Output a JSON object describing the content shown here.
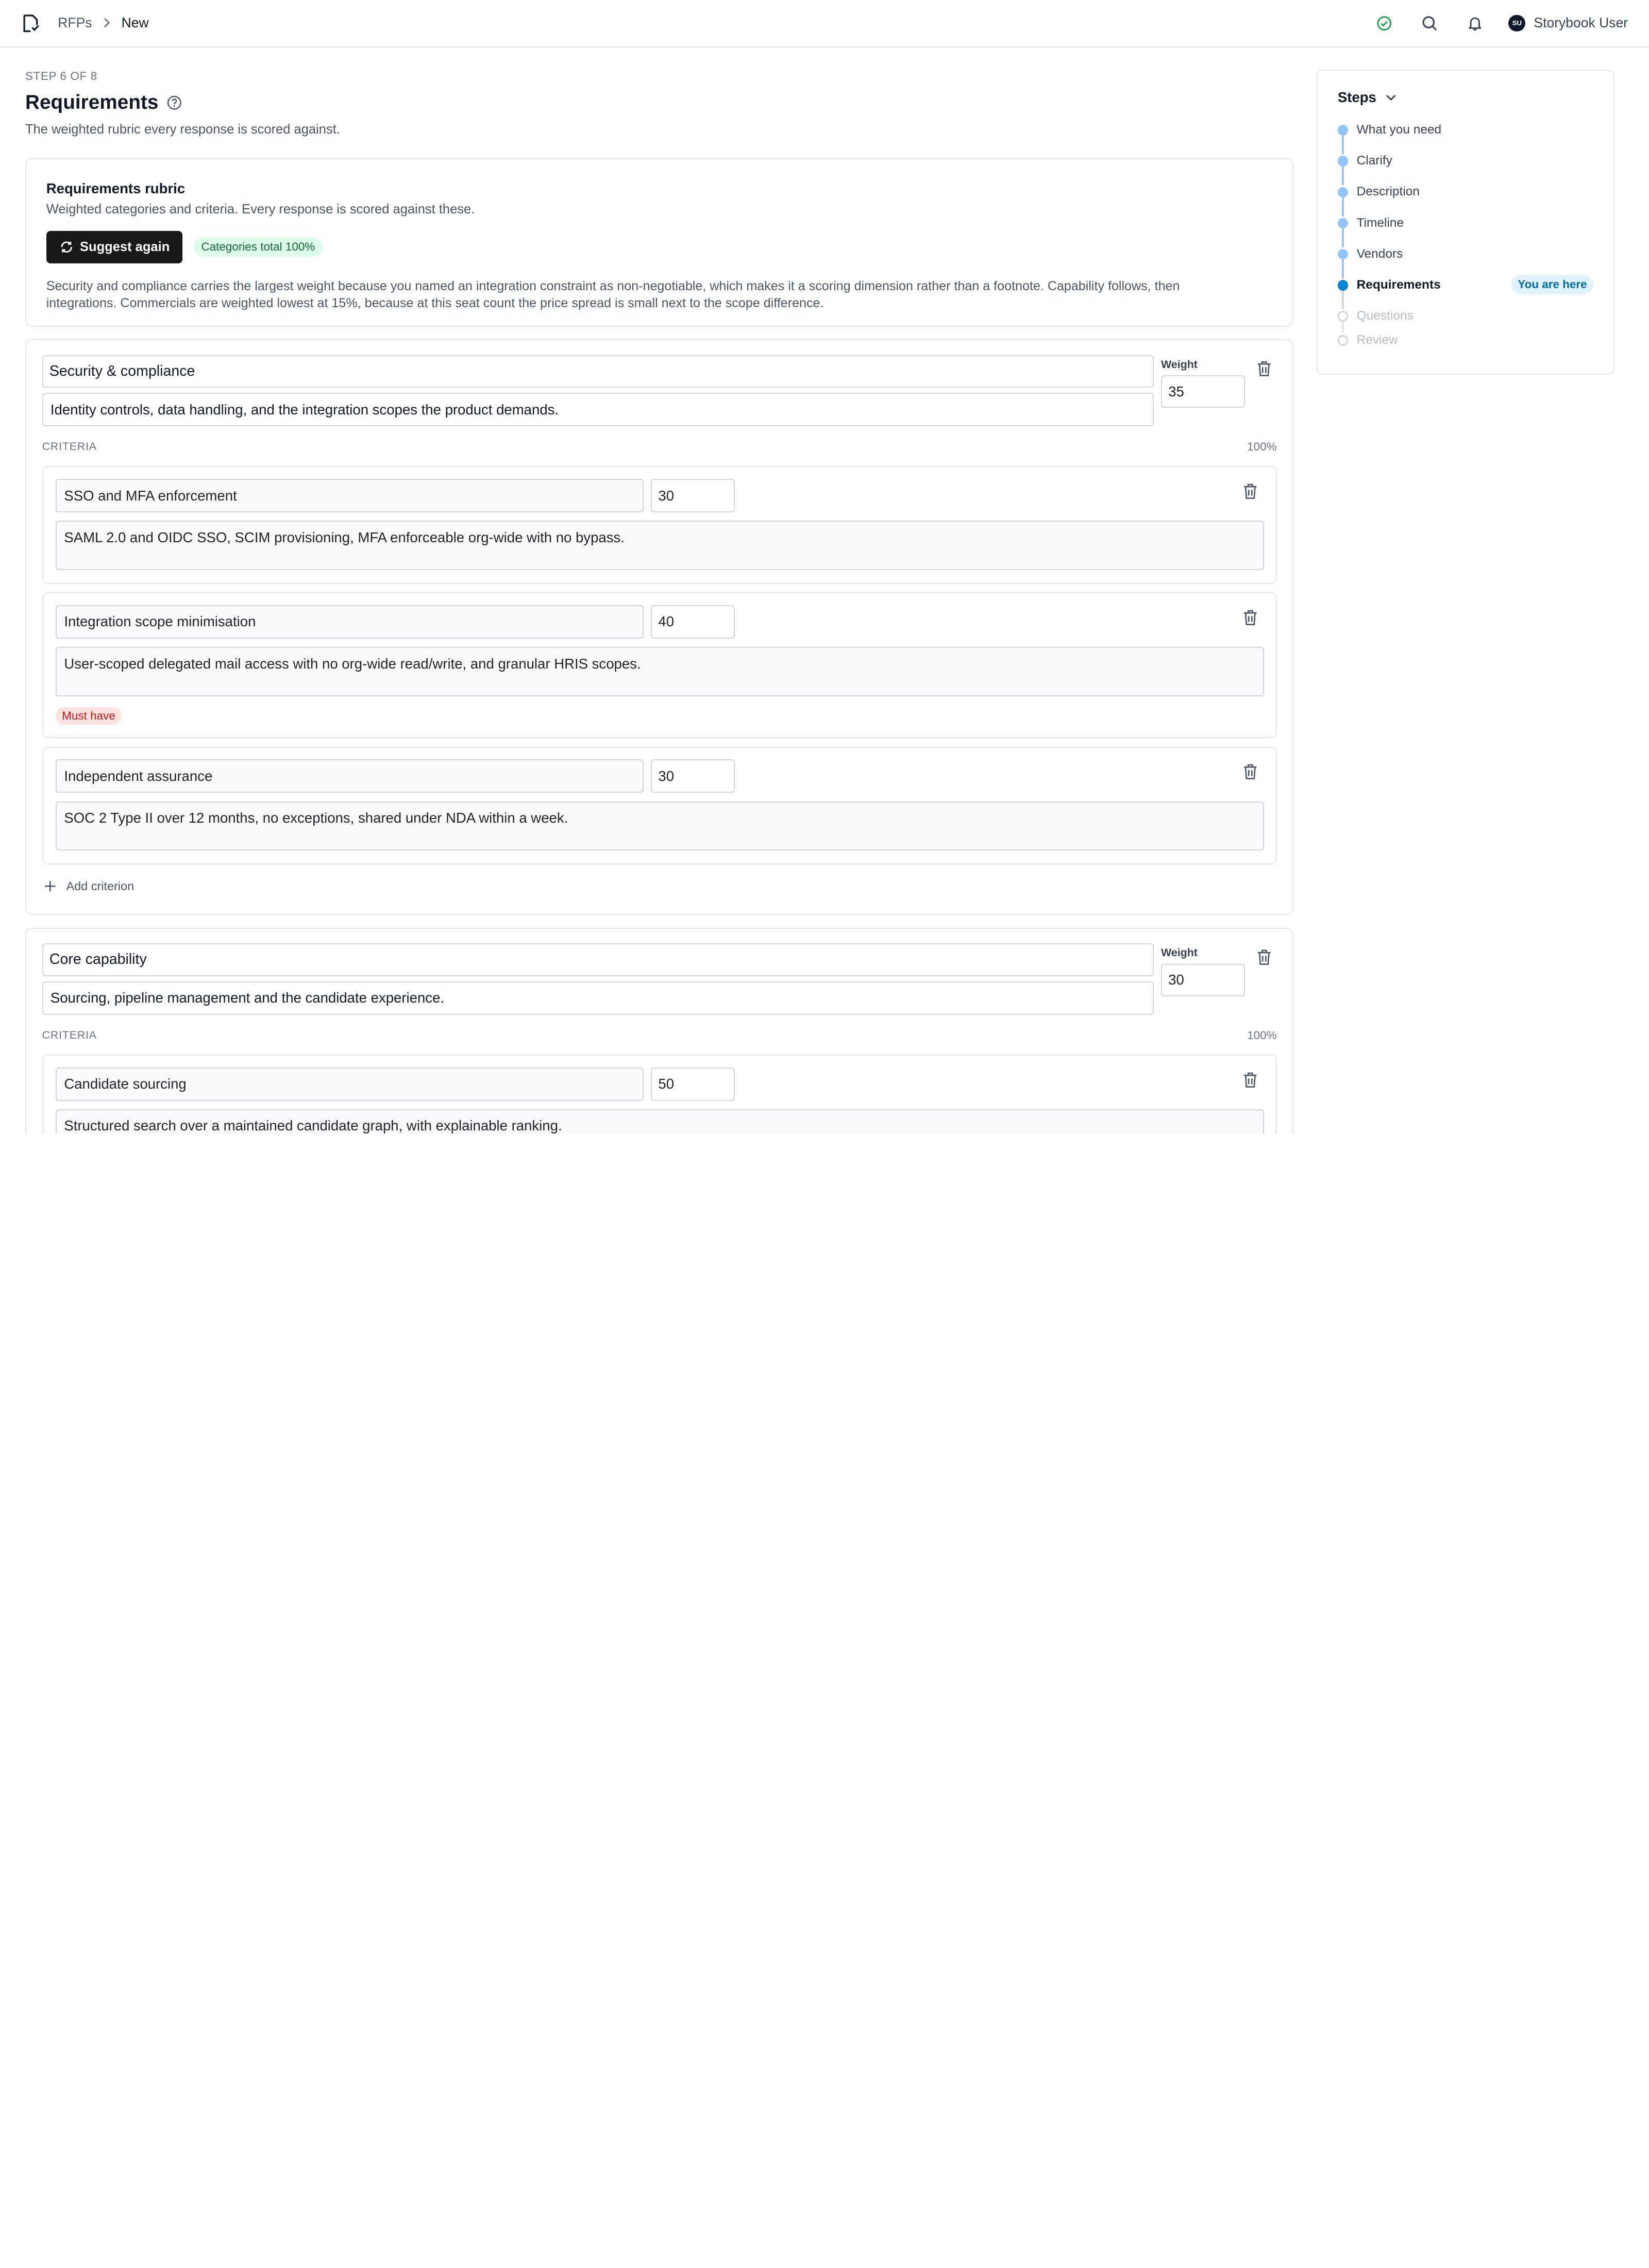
{
  "header": {
    "breadcrumb": [
      "RFPs",
      "New"
    ],
    "user_initials": "SU",
    "user_name": "Storybook User",
    "icons": [
      "app-logo-icon",
      "check-circle-icon",
      "search-icon",
      "bell-icon",
      "chevron-right-icon"
    ]
  },
  "page": {
    "step_label": "STEP 6 OF 8",
    "title": "Requirements",
    "subtitle": "The weighted rubric every response is scored against."
  },
  "rubric": {
    "title": "Requirements rubric",
    "subtitle": "Weighted categories and criteria. Every response is scored against these.",
    "suggest_label": "Suggest again",
    "total_badge": "Categories total 100%",
    "note": "Security and compliance carries the largest weight because you named an integration constraint as non-negotiable, which makes it a scoring dimension rather than a footnote. Capability follows, then integrations. Commercials are weighted lowest at 15%, because at this seat count the price spread is small next to the scope difference."
  },
  "labels": {
    "weight": "Weight",
    "criteria": "CRITERIA",
    "add_criterion": "Add criterion",
    "must_have": "Must have"
  },
  "categories": [
    {
      "name": "Security & compliance",
      "description": "Identity controls, data handling, and the integration scopes the product demands.",
      "weight": "35",
      "criteria_total": "100%",
      "criteria": [
        {
          "name": "SSO and MFA enforcement",
          "weight": "30",
          "description": "SAML 2.0 and OIDC SSO, SCIM provisioning, MFA enforceable org-wide with no bypass.",
          "must_have": false
        },
        {
          "name": "Integration scope minimisation",
          "weight": "40",
          "description": "User-scoped delegated mail access with no org-wide read/write, and granular HRIS scopes.",
          "must_have": true
        },
        {
          "name": "Independent assurance",
          "weight": "30",
          "description": "SOC 2 Type II over 12 months, no exceptions, shared under NDA within a week.",
          "must_have": false
        }
      ]
    },
    {
      "name": "Core capability",
      "description": "Sourcing, pipeline management and the candidate experience.",
      "weight": "30",
      "criteria_total": "100%",
      "criteria": [
        {
          "name": "Candidate sourcing",
          "weight": "50",
          "description": "Structured search over a maintained candidate graph, with explainable ranking.",
          "must_have": false
        }
      ]
    }
  ],
  "steps_panel": {
    "title": "Steps",
    "here_badge": "You are here",
    "steps": [
      {
        "label": "What you need",
        "state": "done"
      },
      {
        "label": "Clarify",
        "state": "done"
      },
      {
        "label": "Description",
        "state": "done"
      },
      {
        "label": "Timeline",
        "state": "done"
      },
      {
        "label": "Vendors",
        "state": "done"
      },
      {
        "label": "Requirements",
        "state": "current"
      },
      {
        "label": "Questions",
        "state": "future"
      },
      {
        "label": "Review",
        "state": "future"
      }
    ]
  },
  "colors": {
    "accent": "#0a84d4",
    "step_done": "#93c5fd",
    "success": "#16a34a",
    "danger": "#b91c1c",
    "button_dark": "#18181b"
  }
}
